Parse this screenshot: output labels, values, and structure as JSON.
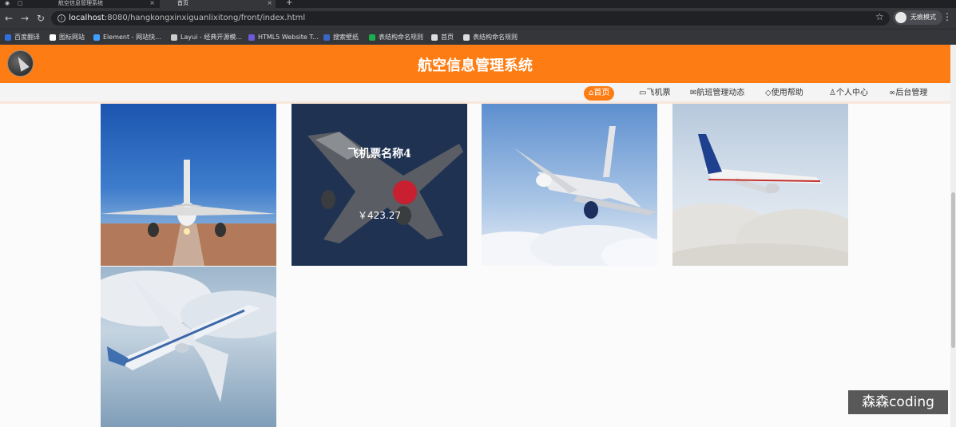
{
  "browser": {
    "tabs": [
      {
        "label": "航空信息管理系统"
      },
      {
        "label": "首页"
      }
    ],
    "new_tab": "+",
    "url_host": "localhost",
    "url_path": ":8080/hangkongxinxiguanlixitong/front/index.html",
    "profile_label": "无痕模式",
    "bookmarks": [
      {
        "label": "百度翻译",
        "color": "#2f6fe0"
      },
      {
        "label": "图标网站",
        "color": "#ffffff"
      },
      {
        "label": "Element - 网站快...",
        "color": "#409eff"
      },
      {
        "label": "Layui - 经典开源模...",
        "color": "#cccccc"
      },
      {
        "label": "HTML5 Website T...",
        "color": "#6b5bd6"
      },
      {
        "label": "搜索壁纸",
        "color": "#3a66c4"
      },
      {
        "label": "表结构命名规则",
        "color": "#1aad4b"
      },
      {
        "label": "首页",
        "color": "#dddddd"
      },
      {
        "label": "表结构命名规则",
        "color": "#dddddd"
      }
    ]
  },
  "header": {
    "title": "航空信息管理系统"
  },
  "nav": {
    "items": [
      {
        "label": "首页",
        "icon": "home-icon"
      },
      {
        "label": "飞机票",
        "icon": "ticket-icon"
      },
      {
        "label": "航班管理动态",
        "icon": "message-icon"
      },
      {
        "label": "使用帮助",
        "icon": "tag-icon"
      },
      {
        "label": "个人中心",
        "icon": "user-icon"
      },
      {
        "label": "后台管理",
        "icon": "link-icon"
      }
    ]
  },
  "cards": [
    {
      "name": "",
      "price": ""
    },
    {
      "name": "飞机票名称4",
      "price": "￥423.27"
    },
    {
      "name": "",
      "price": ""
    },
    {
      "name": "",
      "price": ""
    },
    {
      "name": "",
      "price": ""
    }
  ],
  "watermark": "森森coding",
  "colors": {
    "brand_orange": "#fd7d14",
    "card_hover_bg": "#1f3252"
  }
}
